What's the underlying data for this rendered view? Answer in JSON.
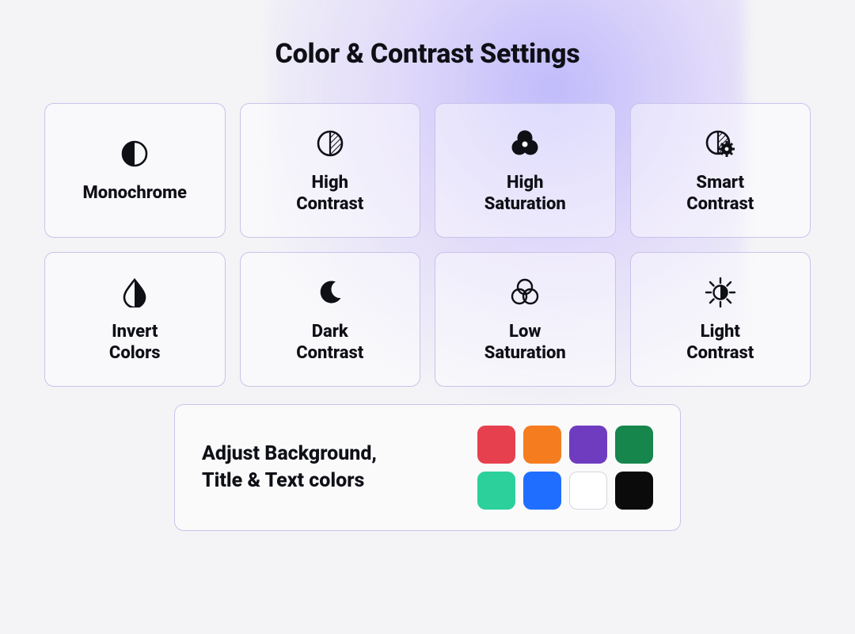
{
  "title": "Color & Contrast Settings",
  "options": {
    "monochrome": {
      "label": "Monochrome"
    },
    "high_contrast": {
      "label": "High\nContrast"
    },
    "high_saturation": {
      "label": "High\nSaturation"
    },
    "smart_contrast": {
      "label": "Smart\nContrast"
    },
    "invert_colors": {
      "label": "Invert\nColors"
    },
    "dark_contrast": {
      "label": "Dark\nContrast"
    },
    "low_saturation": {
      "label": "Low\nSaturation"
    },
    "light_contrast": {
      "label": "Light\nContrast"
    }
  },
  "adjust": {
    "label": "Adjust Background,\nTitle & Text colors",
    "swatches": {
      "red": "#e6404e",
      "orange": "#f57c1f",
      "purple": "#6f3cc0",
      "green": "#16864c",
      "teal": "#2bd09b",
      "blue": "#1f6eff",
      "white": "#ffffff",
      "black": "#0b0b0b"
    }
  }
}
